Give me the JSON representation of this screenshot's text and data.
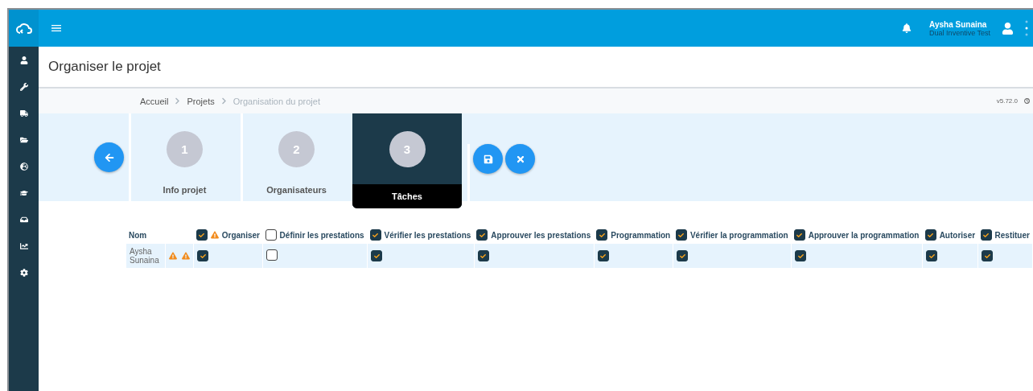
{
  "user": {
    "name": "Aysha Sunaina",
    "company": "Dual Inventive Test"
  },
  "page_title": "Organiser le projet",
  "breadcrumb": [
    {
      "label": "Accueil",
      "current": false
    },
    {
      "label": "Projets",
      "current": false
    },
    {
      "label": "Organisation du projet",
      "current": true
    }
  ],
  "version": "v5.72.0",
  "steps": [
    {
      "number": "1",
      "label": "Info projet",
      "selected": false
    },
    {
      "number": "2",
      "label": "Organisateurs",
      "selected": false
    },
    {
      "number": "3",
      "label": "Tâches",
      "selected": true
    }
  ],
  "table": {
    "name_header": "Nom",
    "columns": [
      {
        "label": "Organiser",
        "checked": true,
        "warning": true
      },
      {
        "label": "Définir les prestations",
        "checked": false,
        "warning": false
      },
      {
        "label": "Vérifier les prestations",
        "checked": true,
        "warning": false
      },
      {
        "label": "Approuver les prestations",
        "checked": true,
        "warning": false
      },
      {
        "label": "Programmation",
        "checked": true,
        "warning": false
      },
      {
        "label": "Vérifier la programmation",
        "checked": true,
        "warning": false
      },
      {
        "label": "Approuver la programmation",
        "checked": true,
        "warning": false
      },
      {
        "label": "Autoriser",
        "checked": true,
        "warning": false
      },
      {
        "label": "Restituer",
        "checked": true,
        "warning": false
      }
    ],
    "rows": [
      {
        "name": "Aysha Sunaina",
        "warning": true,
        "checks": [
          true,
          false,
          true,
          true,
          true,
          true,
          true,
          true,
          true
        ]
      }
    ]
  }
}
